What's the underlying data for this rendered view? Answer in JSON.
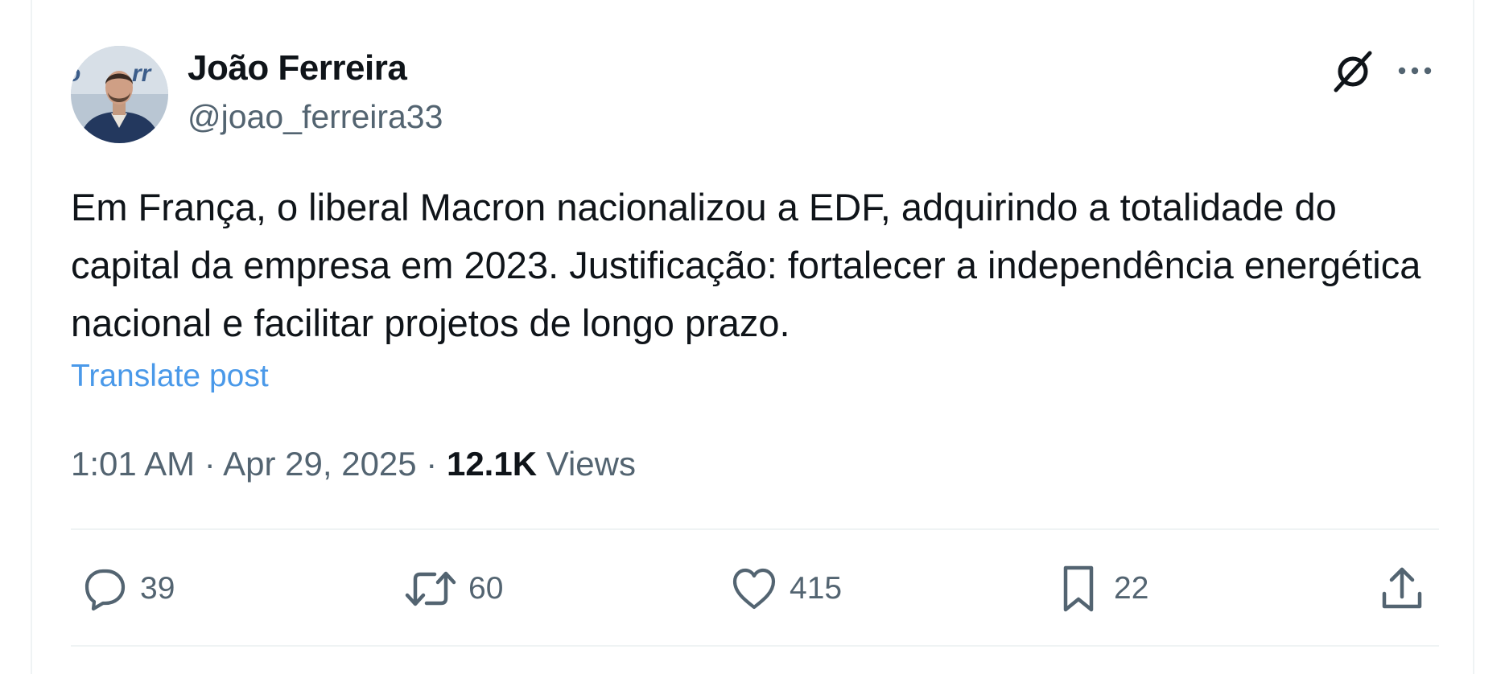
{
  "author": {
    "display_name": "João Ferreira",
    "handle": "@joao_ferreira33"
  },
  "icons": {
    "grok": "grok-icon",
    "more": "more-horizontal-icon",
    "reply": "speech-bubble-icon",
    "repost": "repost-arrows-icon",
    "like": "heart-icon",
    "bookmark": "bookmark-icon",
    "share": "share-upload-icon"
  },
  "post": {
    "text": "Em França, o liberal Macron nacionalizou a EDF, adquirindo a totalidade do capital da empresa em 2023. Justificação: fortalecer a independência energética nacional e facilitar projetos de longo prazo.",
    "translate_label": "Translate post",
    "time": "1:01 AM",
    "date": "Apr 29, 2025",
    "views_count": "12.1K",
    "views_label": "Views"
  },
  "actions": {
    "replies": "39",
    "reposts": "60",
    "likes": "415",
    "bookmarks": "22"
  },
  "colors": {
    "link": "#4a99e9",
    "secondary_text": "#536471",
    "primary_text": "#0f1419",
    "divider": "#eff3f4"
  }
}
